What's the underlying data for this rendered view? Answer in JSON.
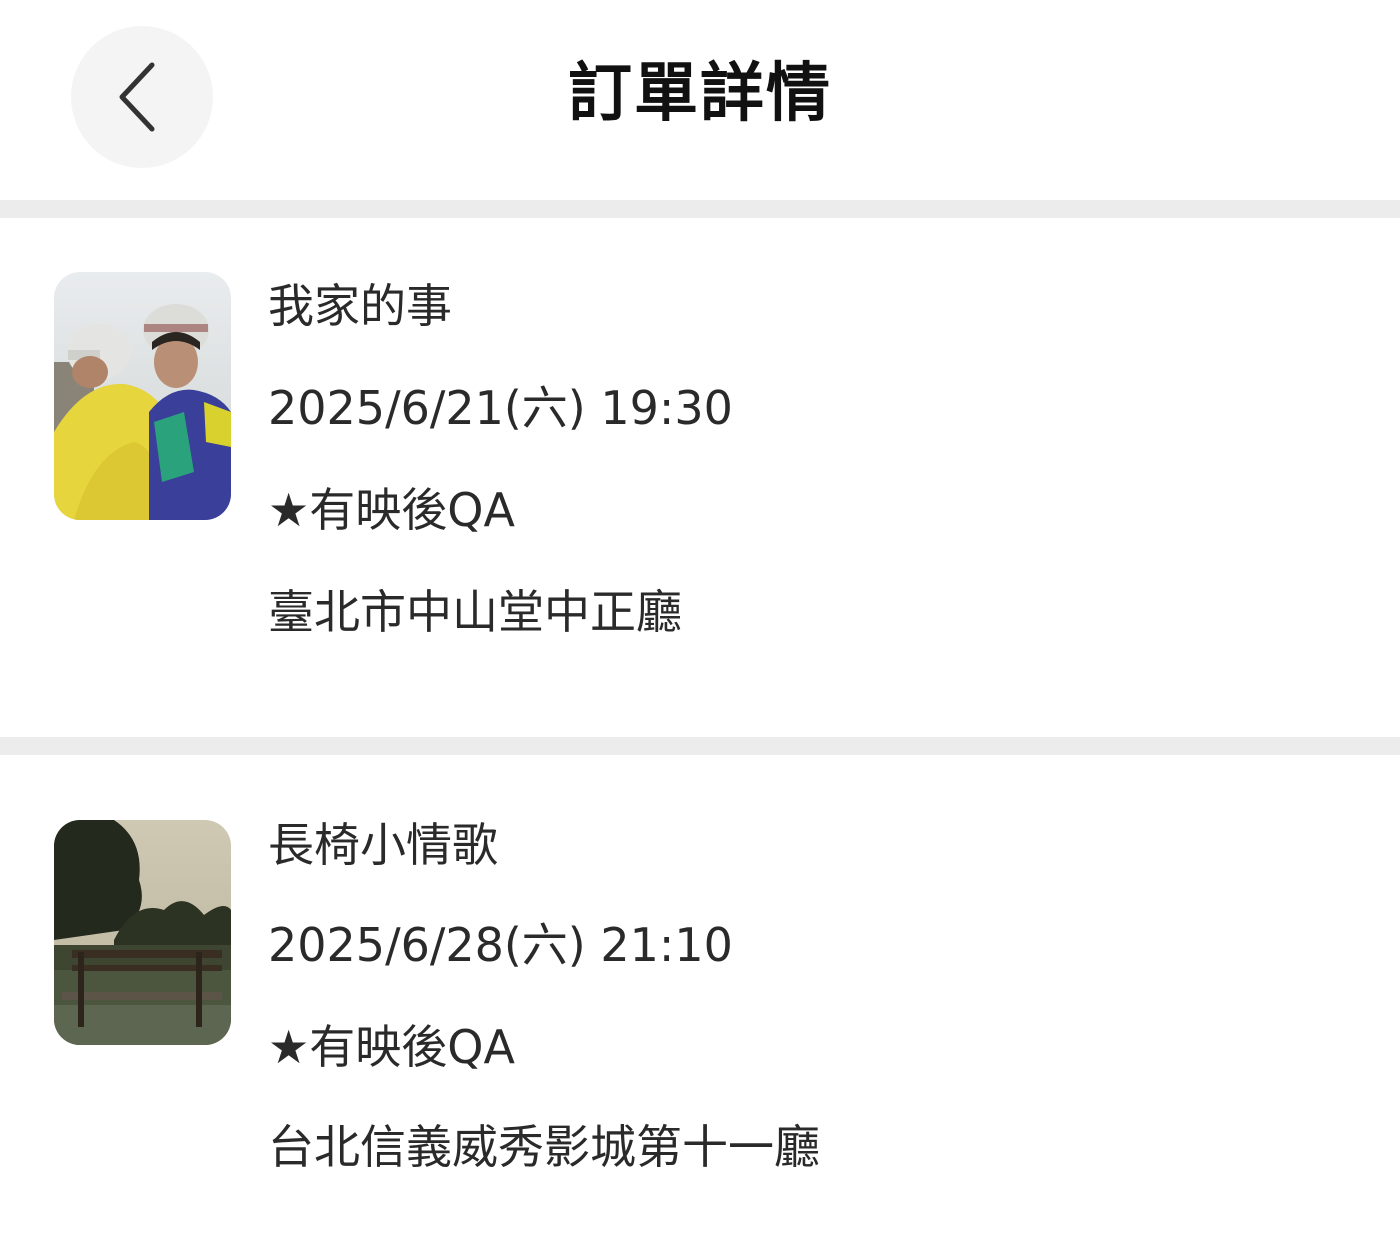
{
  "header": {
    "title": "訂單詳情",
    "back_icon": "chevron-left-icon"
  },
  "orders": [
    {
      "movie_title": "我家的事",
      "datetime": "2025/6/21(六) 19:30",
      "note": "★有映後QA",
      "venue": "臺北市中山堂中正廳",
      "poster_icon": "movie-poster-image"
    },
    {
      "movie_title": "長椅小情歌",
      "datetime": "2025/6/28(六) 21:10",
      "note": "★有映後QA",
      "venue": "台北信義威秀影城第十一廳",
      "poster_icon": "movie-poster-image"
    }
  ],
  "colors": {
    "background": "#ffffff",
    "divider": "#ececec",
    "back_button_bg": "#f4f4f4",
    "text_primary": "#222222"
  }
}
